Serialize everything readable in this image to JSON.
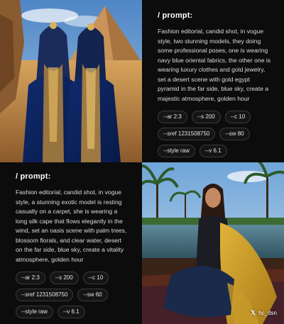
{
  "panel_top": {
    "heading": "/ prompt:",
    "text": "Fashion editorial, candid shot, in vogue style, two stunning models, they doing some professional poses, one is wearing navy blue oriental fabrics, the other one is wearing luxury clothes and gold jewelry, set a desert scene with gold egypt pyramid in the far side, blue sky, create a majestic atmosphere, golden hour",
    "params": [
      "--ar 2:3",
      "--s 200",
      "--c 10",
      "--sref 1231508750",
      "--sw 80",
      "--style raw",
      "--v 6.1"
    ]
  },
  "panel_bottom": {
    "heading": "/ prompt:",
    "text": "Fashion editorial, candid shot, in vogue style, a stunning exotic model is resting casually on a carpet, she is wearing a long silk cape that flows elegantly in the wind, set an oasis scene with palm trees, blossom florals, and clear water, desert on the far side, blue sky, create a vitality atmosphere, golden hour",
    "params": [
      "--ar 2:3",
      "--s 200",
      "--c 10",
      "--sref 1231508750",
      "--sw 60",
      "--style raw",
      "--v 6.1"
    ]
  },
  "credit": {
    "icon": "x-logo-icon",
    "handle": "hc_dsn"
  }
}
